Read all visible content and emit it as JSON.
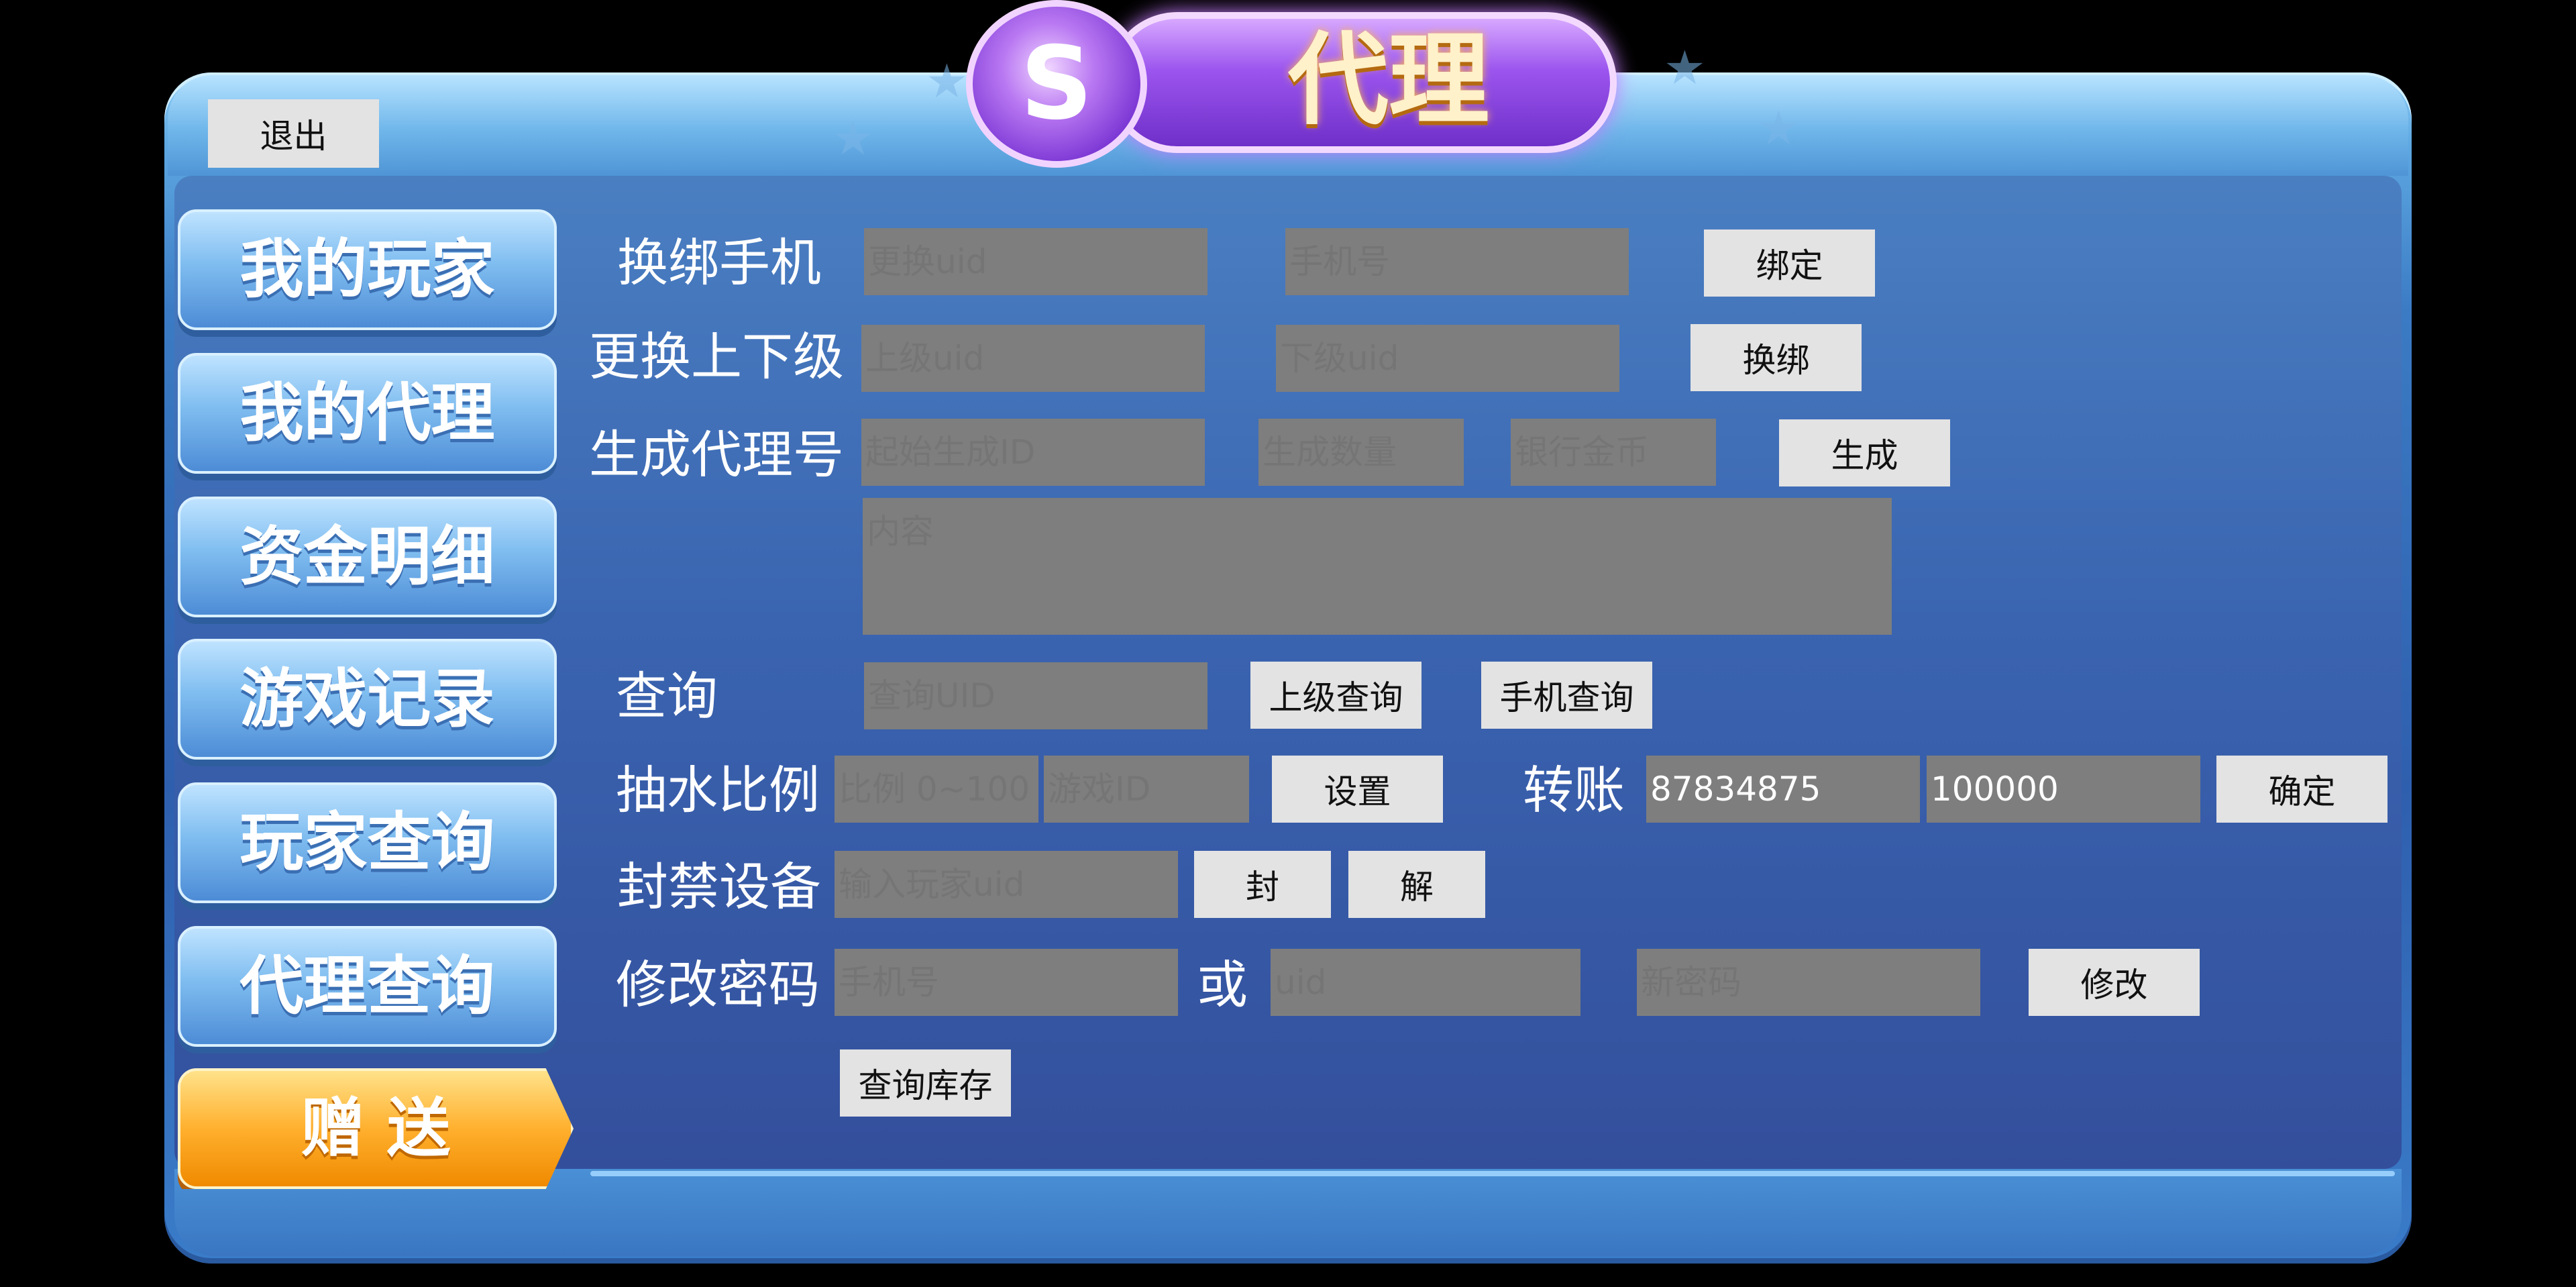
{
  "header": {
    "title": "代理",
    "coin_symbol": "S"
  },
  "exit_label": "退出",
  "sidebar": {
    "items": [
      {
        "label": "我的玩家"
      },
      {
        "label": "我的代理"
      },
      {
        "label": "资金明细"
      },
      {
        "label": "游戏记录"
      },
      {
        "label": "玩家查询"
      },
      {
        "label": "代理查询"
      },
      {
        "label": "赠 送"
      }
    ]
  },
  "form": {
    "rebind_phone": {
      "label": "换绑手机",
      "uid_placeholder": "更换uid",
      "phone_placeholder": "手机号",
      "button": "绑定"
    },
    "change_superior": {
      "label": "更换上下级",
      "upper_placeholder": "上级uid",
      "lower_placeholder": "下级uid",
      "button": "换绑"
    },
    "generate_agent": {
      "label": "生成代理号",
      "start_placeholder": "起始生成ID",
      "count_placeholder": "生成数量",
      "coins_placeholder": "银行金币",
      "button": "生成"
    },
    "content": {
      "placeholder": "内容"
    },
    "query": {
      "label": "查询",
      "uid_placeholder": "查询UID",
      "superior_button": "上级查询",
      "phone_button": "手机查询"
    },
    "rake": {
      "label": "抽水比例",
      "ratio_placeholder": "比例 0~100",
      "gameid_placeholder": "游戏ID",
      "button": "设置"
    },
    "transfer": {
      "label": "转账",
      "account_value": "87834875",
      "amount_value": "100000",
      "button": "确定"
    },
    "ban_device": {
      "label": "封禁设备",
      "uid_placeholder": "输入玩家uid",
      "ban_button": "封",
      "unban_button": "解"
    },
    "change_password": {
      "label": "修改密码",
      "phone_placeholder": "手机号",
      "or_label": "或",
      "uid_placeholder": "uid",
      "newpass_placeholder": "新密码",
      "button": "修改"
    },
    "inventory_button": "查询库存"
  }
}
